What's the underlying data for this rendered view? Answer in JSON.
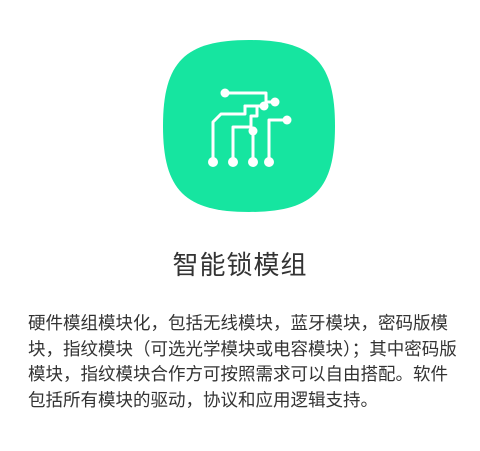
{
  "module": {
    "icon": "circuit-board-icon",
    "icon_color": "#16E5A0",
    "title": "智能锁模组",
    "description": "硬件模组模块化，包括无线模块，蓝牙模块，密码版模块，指纹模块（可选光学模块或电容模块）；其中密码版模块，指纹模块合作方可按照需求可以自由搭配。软件包括所有模块的驱动，协议和应用逻辑支持。"
  }
}
